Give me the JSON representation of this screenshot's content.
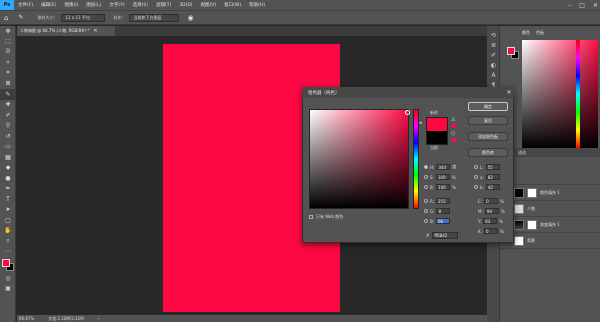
{
  "menubar": {
    "logo": "Ps",
    "items": [
      "文件(F)",
      "编辑(E)",
      "图像(I)",
      "图层(L)",
      "文字(Y)",
      "选择(S)",
      "滤镜(T)",
      "3D(D)",
      "视图(V)",
      "窗口(W)",
      "帮助(H)"
    ]
  },
  "options": {
    "sample_size_label": "取样大小：",
    "sample_size_value": "11 x 11 平均",
    "sample_label": "样本：",
    "sample_value": "当前和下方图层"
  },
  "document": {
    "tab_title": "人物海报 @ 66.7% (人物, RGB/8#) *",
    "zoom": "66.67%",
    "doc_info": "文档:1.18M/2.42M"
  },
  "color_panel": {
    "tab1": "颜色",
    "tab2": "色板"
  },
  "layers_panel": {
    "tab1": "图层",
    "tab2": "通道",
    "layers": [
      {
        "name": "颜色填充 1"
      },
      {
        "name": "人物"
      },
      {
        "name": "渐变填充 1"
      },
      {
        "name": "背景"
      }
    ]
  },
  "picker": {
    "title": "拾色器（纯色）",
    "new_label": "新的",
    "current_label": "当前",
    "buttons": {
      "ok": "确定",
      "reset": "复位",
      "add_swatch": "添加到色板",
      "libraries": "颜色库"
    },
    "web_only": "只有 Web 颜色",
    "hsb": [
      {
        "label": "H:",
        "value": "344",
        "unit": "度"
      },
      {
        "label": "S:",
        "value": "100",
        "unit": "%"
      },
      {
        "label": "B:",
        "value": "100",
        "unit": "%"
      }
    ],
    "rgb": [
      {
        "label": "R:",
        "value": "255"
      },
      {
        "label": "G:",
        "value": "8"
      },
      {
        "label": "B:",
        "value": "66"
      }
    ],
    "lab": [
      {
        "label": "L:",
        "value": "55"
      },
      {
        "label": "a:",
        "value": "82"
      },
      {
        "label": "b:",
        "value": "42"
      }
    ],
    "cmyk": [
      {
        "label": "C:",
        "value": "0",
        "unit": "%"
      },
      {
        "label": "M:",
        "value": "94",
        "unit": "%"
      },
      {
        "label": "Y:",
        "value": "63",
        "unit": "%"
      },
      {
        "label": "K:",
        "value": "0",
        "unit": "%"
      }
    ],
    "hex_label": "#",
    "hex_value": "ff0842"
  },
  "colors": {
    "foreground": "#fe0843",
    "background": "#000000",
    "accent": "#31a8ff"
  }
}
